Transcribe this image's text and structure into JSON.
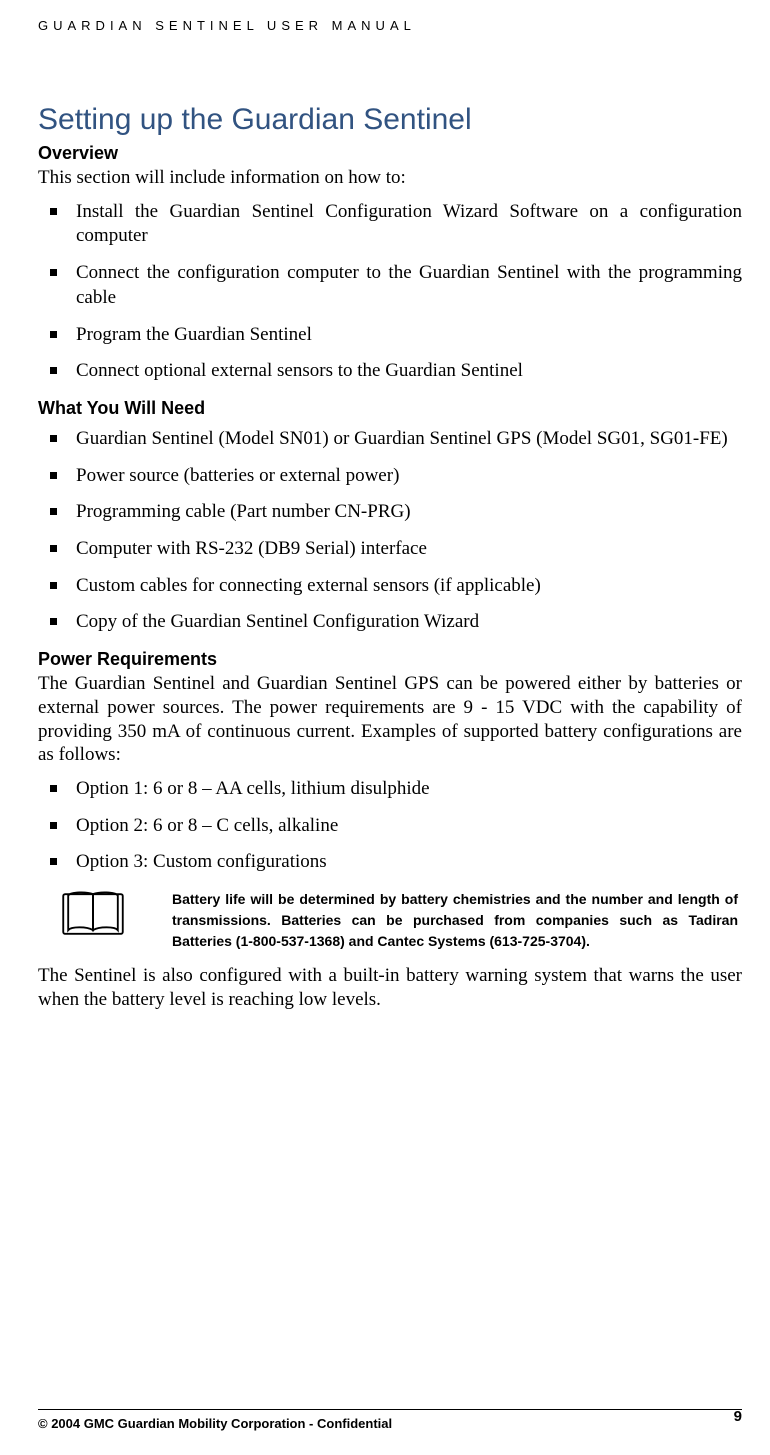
{
  "header": "GUARDIAN SENTINEL USER MANUAL",
  "title": "Setting up the Guardian Sentinel",
  "overview": {
    "heading": "Overview",
    "intro": "This section will include information on how to:",
    "items": [
      "Install the Guardian Sentinel Configuration Wizard Software on a configuration computer",
      "Connect the configuration computer to the Guardian Sentinel with the programming cable",
      "Program the Guardian Sentinel",
      "Connect optional external sensors to the Guardian Sentinel"
    ]
  },
  "need": {
    "heading": "What You Will Need",
    "items": [
      "Guardian Sentinel (Model SN01) or Guardian Sentinel GPS (Model SG01, SG01-FE)",
      "Power source (batteries or external power)",
      "Programming cable (Part number CN-PRG)",
      "Computer with RS-232 (DB9 Serial) interface",
      "Custom cables for connecting external sensors (if applicable)",
      "Copy of the Guardian Sentinel Configuration Wizard"
    ]
  },
  "power": {
    "heading": "Power Requirements",
    "intro": "The Guardian Sentinel and Guardian Sentinel GPS can be powered either by batteries or external power sources. The power requirements are 9 - 15 VDC with the capability of providing 350 mA of continuous current. Examples of supported battery configurations are as follows:",
    "items": [
      "Option 1:  6 or 8 – AA cells, lithium disulphide",
      "Option 2:  6 or 8 – C cells, alkaline",
      "Option 3: Custom configurations"
    ],
    "note": "Battery life will be determined by battery chemistries and the number and length of transmissions. Batteries can be purchased from companies such as Tadiran Batteries (1-800-537-1368) and Cantec Systems (613-725-3704).",
    "outro": "The Sentinel is also configured with a built-in battery warning system that warns the user when the battery level is reaching low levels."
  },
  "footer": {
    "left": "© 2004 GMC Guardian Mobility Corporation - Confidential",
    "page": "9"
  }
}
